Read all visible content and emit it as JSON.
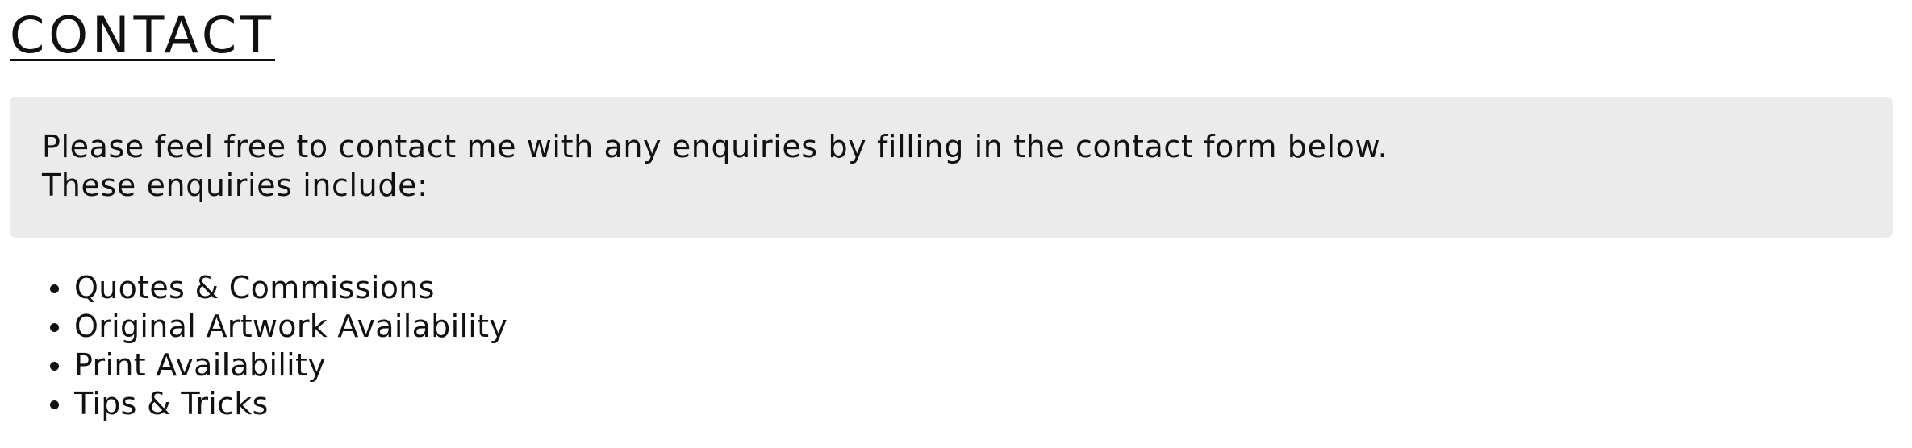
{
  "page": {
    "title": "CONTACT"
  },
  "intro": {
    "line1": "Please feel free to contact me with any enquiries by filling in the contact form below.",
    "line2": "These enquiries include:"
  },
  "enquiries": [
    "Quotes & Commissions",
    "Original Artwork Availability",
    "Print Availability",
    "Tips & Tricks"
  ],
  "colors": {
    "text": "#111111",
    "intro_background": "#ebebeb",
    "page_background": "#ffffff"
  }
}
